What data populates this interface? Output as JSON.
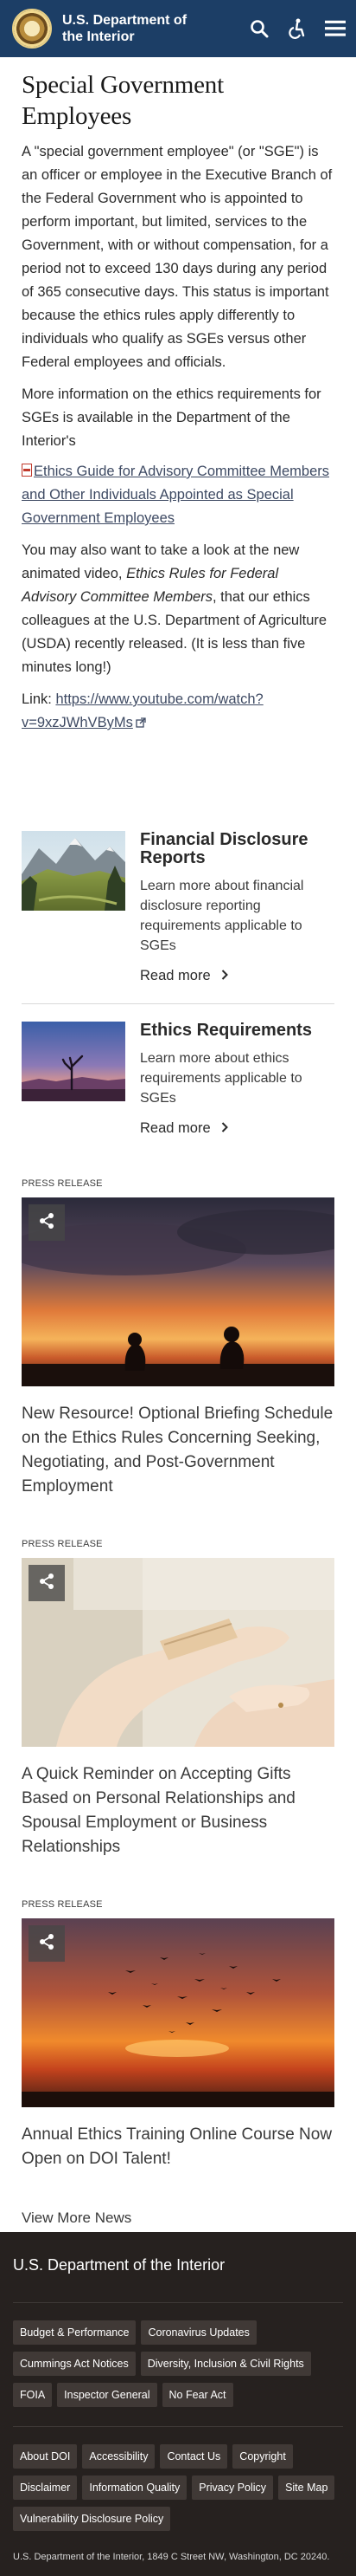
{
  "header": {
    "site_name": "U.S. Department of the Interior",
    "icons": [
      "search-icon",
      "accessibility-icon",
      "menu-icon"
    ]
  },
  "page_title": "Special Government Employees",
  "intro_paragraph": "A \"special government employee\" (or \"SGE\") is an officer or employee in the Executive Branch of the Federal Government who is appointed to perform important, but limited, services to the Government, with or without compensation, for a period not to exceed 130 days during any period of 365 consecutive days. This status is important because the ethics rules apply differently to individuals who qualify as SGEs versus other Federal employees and officials.",
  "more_info_paragraph": "More information on the ethics requirements for SGEs is available in the Department of the Interior's",
  "pdf_link": "Ethics Guide for Advisory Committee Members and Other Individuals Appointed as Special Government Employees",
  "video_paragraph": {
    "before": "You may also want to take a look at the new animated video, ",
    "title": "Ethics Rules for Federal Advisory Committee Members",
    "after": ", that our ethics colleagues at the U.S. Department of Agriculture (USDA) recently released.  (It is less than five minutes long!)"
  },
  "video_link": {
    "label": "Link: ",
    "url": "https://www.youtube.com/watch?v=9xzJWhVByMs"
  },
  "cards": [
    {
      "title": "Financial Disclosure Reports",
      "text": "Learn more about financial disclosure reporting requirements applicable to SGEs",
      "link": "Read more"
    },
    {
      "title": "Ethics Requirements",
      "text": "Learn more about ethics requirements applicable to SGEs",
      "link": "Read more"
    }
  ],
  "press_releases": [
    {
      "kicker": "Press Release",
      "title": "New Resource! Optional Briefing Schedule on the Ethics Rules Concerning Seeking, Negotiating, and Post-Government Employment"
    },
    {
      "kicker": "Press Release",
      "title": "A Quick Reminder on Accepting Gifts Based on Personal Relationships and Spousal Employment or Business Relationships"
    },
    {
      "kicker": "Press Release",
      "title": "Annual Ethics Training Online Course Now Open on DOI Talent!"
    }
  ],
  "view_more": "View More News",
  "footer": {
    "title": "U.S. Department of the Interior",
    "links_primary": [
      "Budget & Performance",
      "Coronavirus Updates",
      "Cummings Act Notices",
      "Diversity, Inclusion & Civil Rights",
      "FOIA",
      "Inspector General",
      "No Fear Act"
    ],
    "links_secondary": [
      "About DOI",
      "Accessibility",
      "Contact Us",
      "Copyright",
      "Disclaimer",
      "Information Quality",
      "Privacy Policy",
      "Site Map",
      "Vulnerability Disclosure Policy"
    ],
    "address": "U.S. Department of the Interior, 1849 C Street NW, Washington, DC 20240."
  },
  "colors": {
    "header_bg": "#1c3e66",
    "footer_bg": "#26211f",
    "link": "#3e4a63"
  }
}
